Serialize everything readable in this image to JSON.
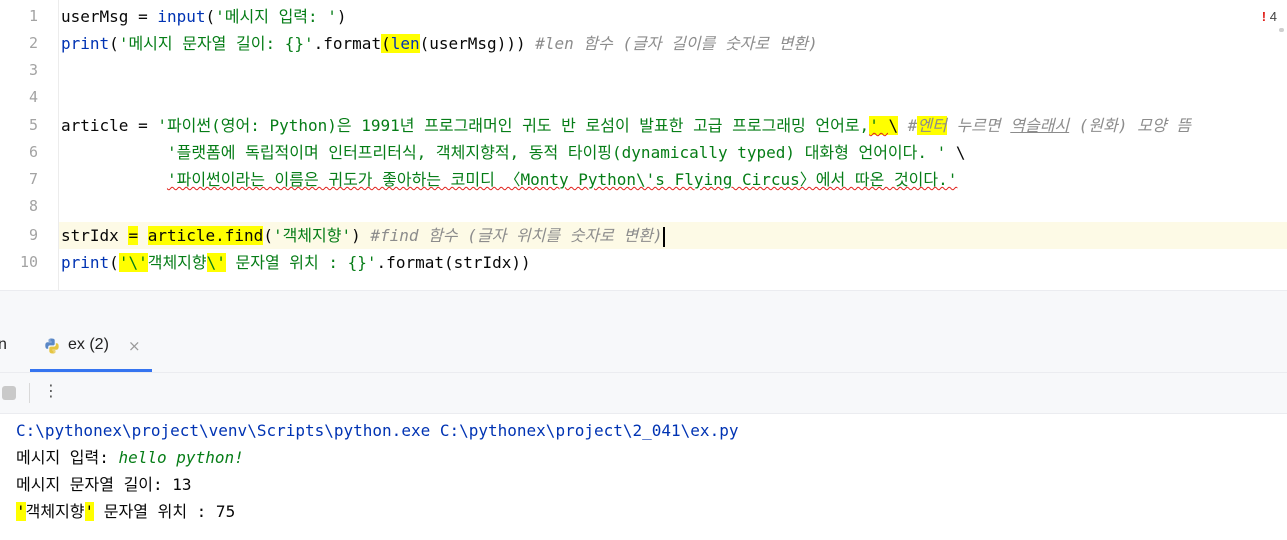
{
  "editor": {
    "line_numbers": [
      "1",
      "2",
      "3",
      "4",
      "5",
      "6",
      "7",
      "8",
      "9",
      "10"
    ],
    "inspection_count": "4",
    "lines": {
      "l1": {
        "a": "userMsg = ",
        "b": "input",
        "c": "(",
        "d": "'메시지 입력: '",
        "e": ")"
      },
      "l2": {
        "a": "print",
        "b": "(",
        "c": "'메시지 문자열 길이: {}'",
        "d": ".format",
        "e": "(",
        "f": "len",
        "g": "(userMsg))) ",
        "h": "#len 함수 (글자 길이를 숫자로 변환)"
      },
      "l5": {
        "a": "article = ",
        "b": "'파이썬(영어: Python)은 1991년 프로그래머인 귀도 반 로섬이 발표한 고급 프로그래밍 언어로,",
        "c": "' ",
        "d": "\\",
        "e": " #",
        "f": "엔터",
        "g": " 누르면 ",
        "h": "역슬래시",
        "i": " (원화) 모양 뜸"
      },
      "l6": {
        "a": "           ",
        "b": "'플랫폼에 독립적이며 인터프리터식, 객체지향적, 동적 타이핑(dynamically typed) 대화형 언어이다. '",
        "c": " \\"
      },
      "l7": {
        "a": "           ",
        "b": "'파이썬이라는 이름은 귀도가 좋아하는 코미디 〈Monty Python\\'s Flying Circus〉에서 따온 것이다.'"
      },
      "l9": {
        "a": "strIdx ",
        "b": "=",
        "c": " ",
        "d": "article.find",
        "e": "(",
        "f": "'객체지향'",
        "g": ") ",
        "h": "#find 함수 (글자 위치를 숫자로 변환)"
      },
      "l10": {
        "a": "print",
        "b": "(",
        "c": "'\\'",
        "d": "객체지향",
        "e": "\\'",
        "f": " 문자열 위치 : {}'",
        "g": ".format(strIdx))"
      }
    }
  },
  "run_panel": {
    "prev_tab_label": "n",
    "tab_label": "ex (2)",
    "close_glyph": "×",
    "more_glyph": "⋮"
  },
  "console": {
    "command": "C:\\pythonex\\project\\venv\\Scripts\\python.exe C:\\pythonex\\project\\2_041\\ex.py",
    "prompt": "메시지 입력: ",
    "user_input": "hello python!",
    "length_output": "메시지 문자열 길이: 13",
    "pos_quote1": "'",
    "pos_word": "객체지향",
    "pos_quote2": "'",
    "pos_rest": " 문자열 위치 : 75"
  },
  "colors": {
    "keyword_blue": "#0033b3",
    "string_green": "#067d17",
    "comment_gray": "#8c8c8c",
    "highlight_yellow": "#ffff00",
    "caret_row": "#fdfae6",
    "error_red": "#e0201a",
    "tab_underline": "#3574f0"
  }
}
